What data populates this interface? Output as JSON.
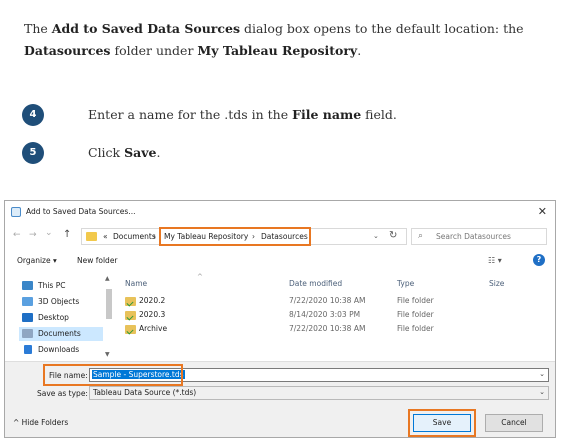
{
  "intro": {
    "t1": "The ",
    "b1": "Add to Saved Data Sources",
    "t2": " dialog box opens to the default location: the ",
    "b2": "Datasources",
    "t3": " folder under ",
    "b3": "My Tableau Repository",
    "t4": "."
  },
  "steps": [
    {
      "num": "4",
      "t1": "Enter a name for the .tds in the ",
      "b1": "File name",
      "t2": " field."
    },
    {
      "num": "5",
      "t1": "Click ",
      "b1": "Save",
      "t2": "."
    }
  ],
  "dialog": {
    "title": "Add to Saved Data Sources...",
    "close_glyph": "✕",
    "nav": {
      "back": "←",
      "forward": "→",
      "history": "⌄",
      "up": "↑",
      "refresh": "↻",
      "drop": "⌄"
    },
    "address": [
      "«",
      "Documents",
      "›",
      "My Tableau Repository",
      "›",
      "Datasources"
    ],
    "search_placeholder": "Search Datasources",
    "toolbar": {
      "organize": "Organize ▾",
      "new_folder": "New folder",
      "view_glyph": "☷ ▾",
      "help": "?"
    },
    "nav_items": [
      {
        "label": "This PC",
        "color": "#3a86c8"
      },
      {
        "label": "3D Objects",
        "color": "#5aa0e0"
      },
      {
        "label": "Desktop",
        "color": "#1f6fc5"
      },
      {
        "label": "Documents",
        "color": "#8fa6c2"
      },
      {
        "label": "Downloads",
        "color": "#2b7bd6"
      }
    ],
    "columns": {
      "name": "Name",
      "date": "Date modified",
      "type": "Type",
      "size": "Size"
    },
    "files": [
      {
        "name": "2020.2",
        "date": "7/22/2020 10:38 AM",
        "type": "File folder"
      },
      {
        "name": "2020.3",
        "date": "8/14/2020 3:03 PM",
        "type": "File folder"
      },
      {
        "name": "Archive",
        "date": "7/22/2020 10:38 AM",
        "type": "File folder"
      }
    ],
    "file_name_label": "File name:",
    "file_name_value": "Sample - Superstore.tds",
    "save_type_label": "Save as type:",
    "save_type_value": "Tableau Data Source (*.tds)",
    "hide_folders": "^  Hide Folders",
    "save_label": "Save",
    "cancel_label": "Cancel"
  },
  "colors": {
    "highlight": "#e87722",
    "step_badge": "#1f4e79",
    "selection": "#0078d7"
  }
}
